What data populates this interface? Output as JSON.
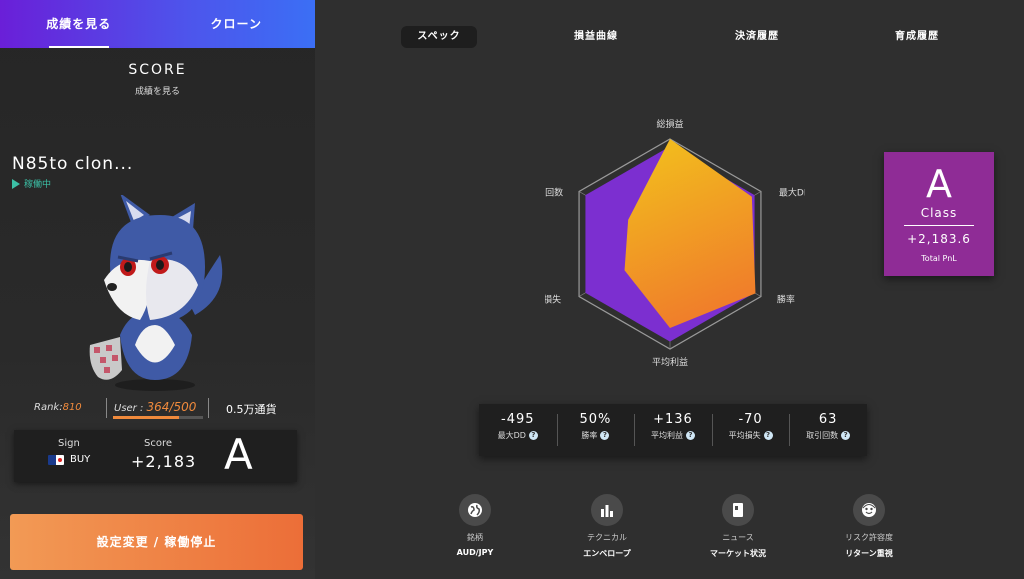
{
  "left_tabs": {
    "score": "成績を見る",
    "clone": "クローン"
  },
  "score": {
    "title": "SCORE",
    "subtitle": "成績を見る"
  },
  "bot": {
    "name": "N85to clon...",
    "status": "稼働中"
  },
  "stats": {
    "rank_label": "Rank:",
    "rank_value": "810",
    "user_label": "User :",
    "user_value": "364/500",
    "user_fraction": 0.728,
    "currency": "0.5万通貨"
  },
  "sign_card": {
    "sign_label": "Sign",
    "pair_side": "BUY",
    "score_label": "Score",
    "score_value": "+2,183",
    "grade": "A"
  },
  "action_button": "設定変更 / 稼働停止",
  "right_tabs": [
    "スペック",
    "損益曲線",
    "決済履歴",
    "育成履歴"
  ],
  "radar": {
    "axes": [
      "総損益",
      "最大DD",
      "勝率",
      "平均利益",
      "平均損失",
      "取引回数"
    ],
    "purple": [
      0.93,
      0.93,
      0.93,
      0.93,
      0.93,
      0.93
    ],
    "gold": [
      1.0,
      0.9,
      0.94,
      0.8,
      0.5,
      0.46
    ],
    "colors": {
      "outer": "#7c2fd0",
      "inner_from": "#f2c21c",
      "inner_to": "#f07f2a"
    }
  },
  "class_card": {
    "letter": "A",
    "word": "Class",
    "pnl": "+2,183.6",
    "pnl_label": "Total PnL",
    "color": "#8f2c96"
  },
  "metrics": [
    {
      "value": "-495",
      "label": "最大DD"
    },
    {
      "value": "50%",
      "label": "勝率"
    },
    {
      "value": "+136",
      "label": "平均利益"
    },
    {
      "value": "-70",
      "label": "平均損失"
    },
    {
      "value": "63",
      "label": "取引回数"
    }
  ],
  "info": [
    {
      "label": "銘柄",
      "value": "AUD/JPY",
      "icon": "globe-icon"
    },
    {
      "label": "テクニカル",
      "value": "エンベロープ",
      "icon": "bar-chart-icon"
    },
    {
      "label": "ニュース",
      "value": "マーケット状況",
      "icon": "news-icon"
    },
    {
      "label": "リスク許容度",
      "value": "リターン重視",
      "icon": "face-icon"
    }
  ]
}
